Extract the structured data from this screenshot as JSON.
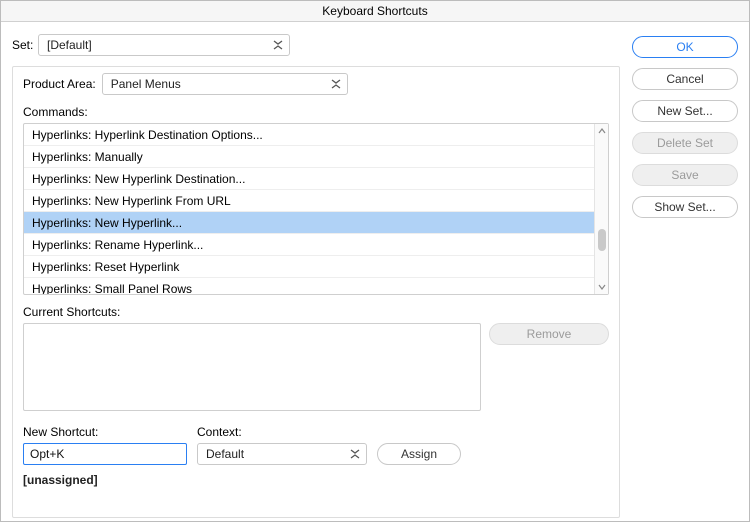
{
  "window": {
    "title": "Keyboard Shortcuts"
  },
  "set": {
    "label": "Set:",
    "value": "[Default]"
  },
  "productArea": {
    "label": "Product Area:",
    "value": "Panel Menus"
  },
  "commands": {
    "label": "Commands:",
    "items": [
      {
        "label": "Hyperlinks: Hyperlink Destination Options...",
        "selected": false
      },
      {
        "label": "Hyperlinks: Manually",
        "selected": false
      },
      {
        "label": "Hyperlinks: New Hyperlink Destination...",
        "selected": false
      },
      {
        "label": "Hyperlinks: New Hyperlink From URL",
        "selected": false
      },
      {
        "label": "Hyperlinks: New Hyperlink...",
        "selected": true
      },
      {
        "label": "Hyperlinks: Rename Hyperlink...",
        "selected": false
      },
      {
        "label": "Hyperlinks: Reset Hyperlink",
        "selected": false
      },
      {
        "label": "Hyperlinks: Small Panel Rows",
        "selected": false
      }
    ]
  },
  "currentShortcuts": {
    "label": "Current Shortcuts:"
  },
  "remove": {
    "label": "Remove"
  },
  "newShortcut": {
    "label": "New Shortcut:",
    "value": "Opt+K"
  },
  "context": {
    "label": "Context:",
    "value": "Default"
  },
  "assign": {
    "label": "Assign"
  },
  "status": {
    "text": "[unassigned]"
  },
  "buttons": {
    "ok": "OK",
    "cancel": "Cancel",
    "newSet": "New Set...",
    "deleteSet": "Delete Set",
    "save": "Save",
    "showSet": "Show Set..."
  }
}
